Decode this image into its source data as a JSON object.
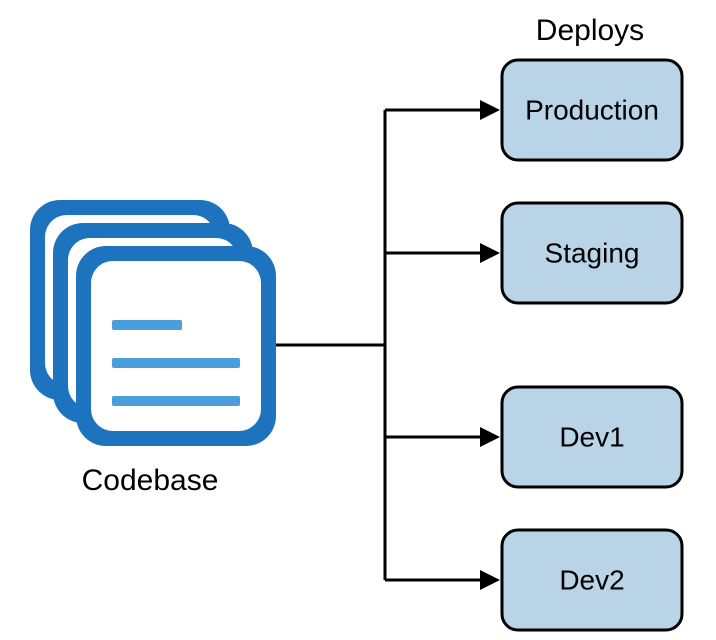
{
  "header": "Deploys",
  "codebase_label": "Codebase",
  "deploys": [
    {
      "label": "Production"
    },
    {
      "label": "Staging"
    },
    {
      "label": "Dev1"
    },
    {
      "label": "Dev2"
    }
  ],
  "colors": {
    "deploy_fill": "#b8d4e6",
    "codebase_blue": "#1e73be",
    "codebase_light": "#4a9edc",
    "line": "#000000"
  }
}
